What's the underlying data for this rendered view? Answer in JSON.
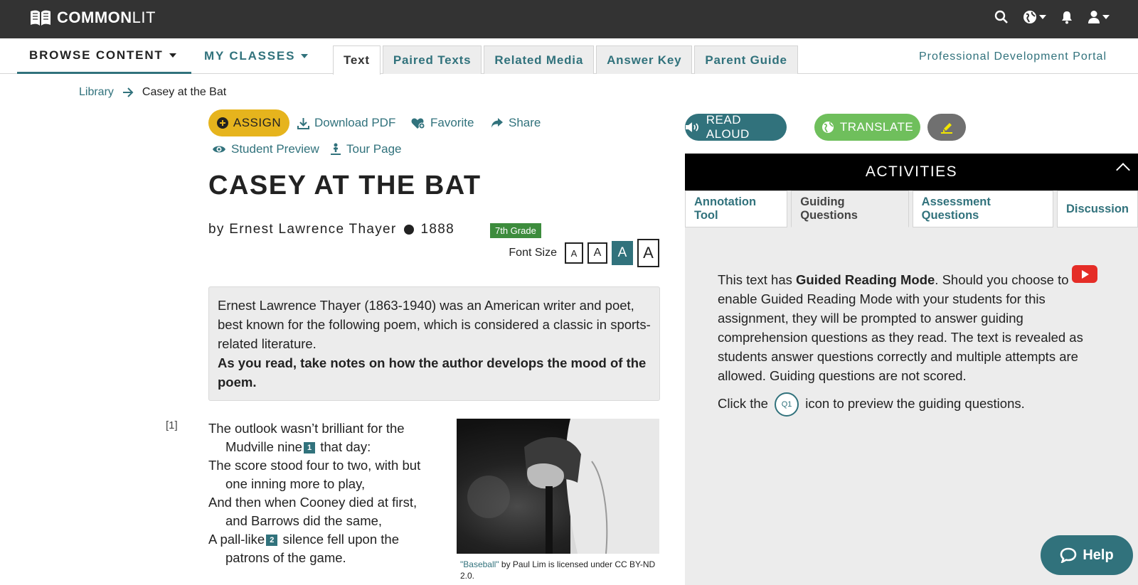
{
  "topbar": {
    "logo_bold": "COMMON",
    "logo_light": "LIT",
    "icons": [
      "search-icon",
      "globe-icon",
      "bell-icon",
      "user-icon"
    ]
  },
  "nav": {
    "browse": "BROWSE CONTENT",
    "classes": "MY CLASSES",
    "tabs": [
      "Text",
      "Paired Texts",
      "Related Media",
      "Answer Key",
      "Parent Guide"
    ],
    "active_tab": "Text",
    "pd_link": "Professional Development Portal"
  },
  "breadcrumb": {
    "library": "Library",
    "current": "Casey at the Bat"
  },
  "actions": {
    "assign": "ASSIGN",
    "download": "Download PDF",
    "favorite": "Favorite",
    "share": "Share",
    "preview": "Student Preview",
    "tour": "Tour Page"
  },
  "text": {
    "title": "CASEY AT THE BAT",
    "author": "by Ernest Lawrence Thayer",
    "year": "1888",
    "grade": "7th Grade",
    "font_size_label": "Font Size",
    "font_sizes": [
      "A",
      "A",
      "A",
      "A"
    ],
    "intro": "Ernest Lawrence Thayer (1863-1940) was an American writer and poet, best known for the following poem, which is considered a classic in sports-related literature.",
    "intro_bold": "As you read, take notes on how the author develops the mood of the poem.",
    "line_number": "[1]",
    "poem": {
      "l1": "The outlook wasn’t brilliant for the",
      "l2a": "Mudville nine",
      "fn1": "1",
      "l2b": " that day:",
      "l3": "The score stood four to two, with but",
      "l4": "one inning more to play,",
      "l5": "And then when Cooney died at first,",
      "l6": "and Barrows did the same,",
      "l7a": "A pall-like",
      "fn2": "2",
      "l7b": " silence fell upon the",
      "l8": "patrons of the game."
    },
    "caption_link": "\"Baseball\"",
    "caption_rest": " by Paul Lim is licensed under CC BY-ND 2.0."
  },
  "panel": {
    "read_aloud": "READ ALOUD",
    "translate": "TRANSLATE",
    "activities": "ACTIVITIES",
    "tabs": [
      "Annotation Tool",
      "Guiding Questions",
      "Assessment Questions",
      "Discussion"
    ],
    "active_tab": "Guiding Questions",
    "guide_p1_a": "This text has ",
    "guide_p1_bold": "Guided Reading Mode",
    "guide_p1_b": ". Should you choose to enable Guided Reading Mode with your students for this assignment, they will be prompted to answer guiding comprehension questions as they read. The text is revealed as students answer questions correctly and multiple attempts are allowed. Guiding questions are not scored.",
    "guide_p2_a": "Click the",
    "q1": "Q1",
    "guide_p2_b": "icon to preview the guiding questions."
  },
  "help": "Help",
  "colors": {
    "accent": "#31727c",
    "assign": "#e6b41d",
    "translate": "#6fbf5c",
    "grade": "#3d8c3d"
  }
}
